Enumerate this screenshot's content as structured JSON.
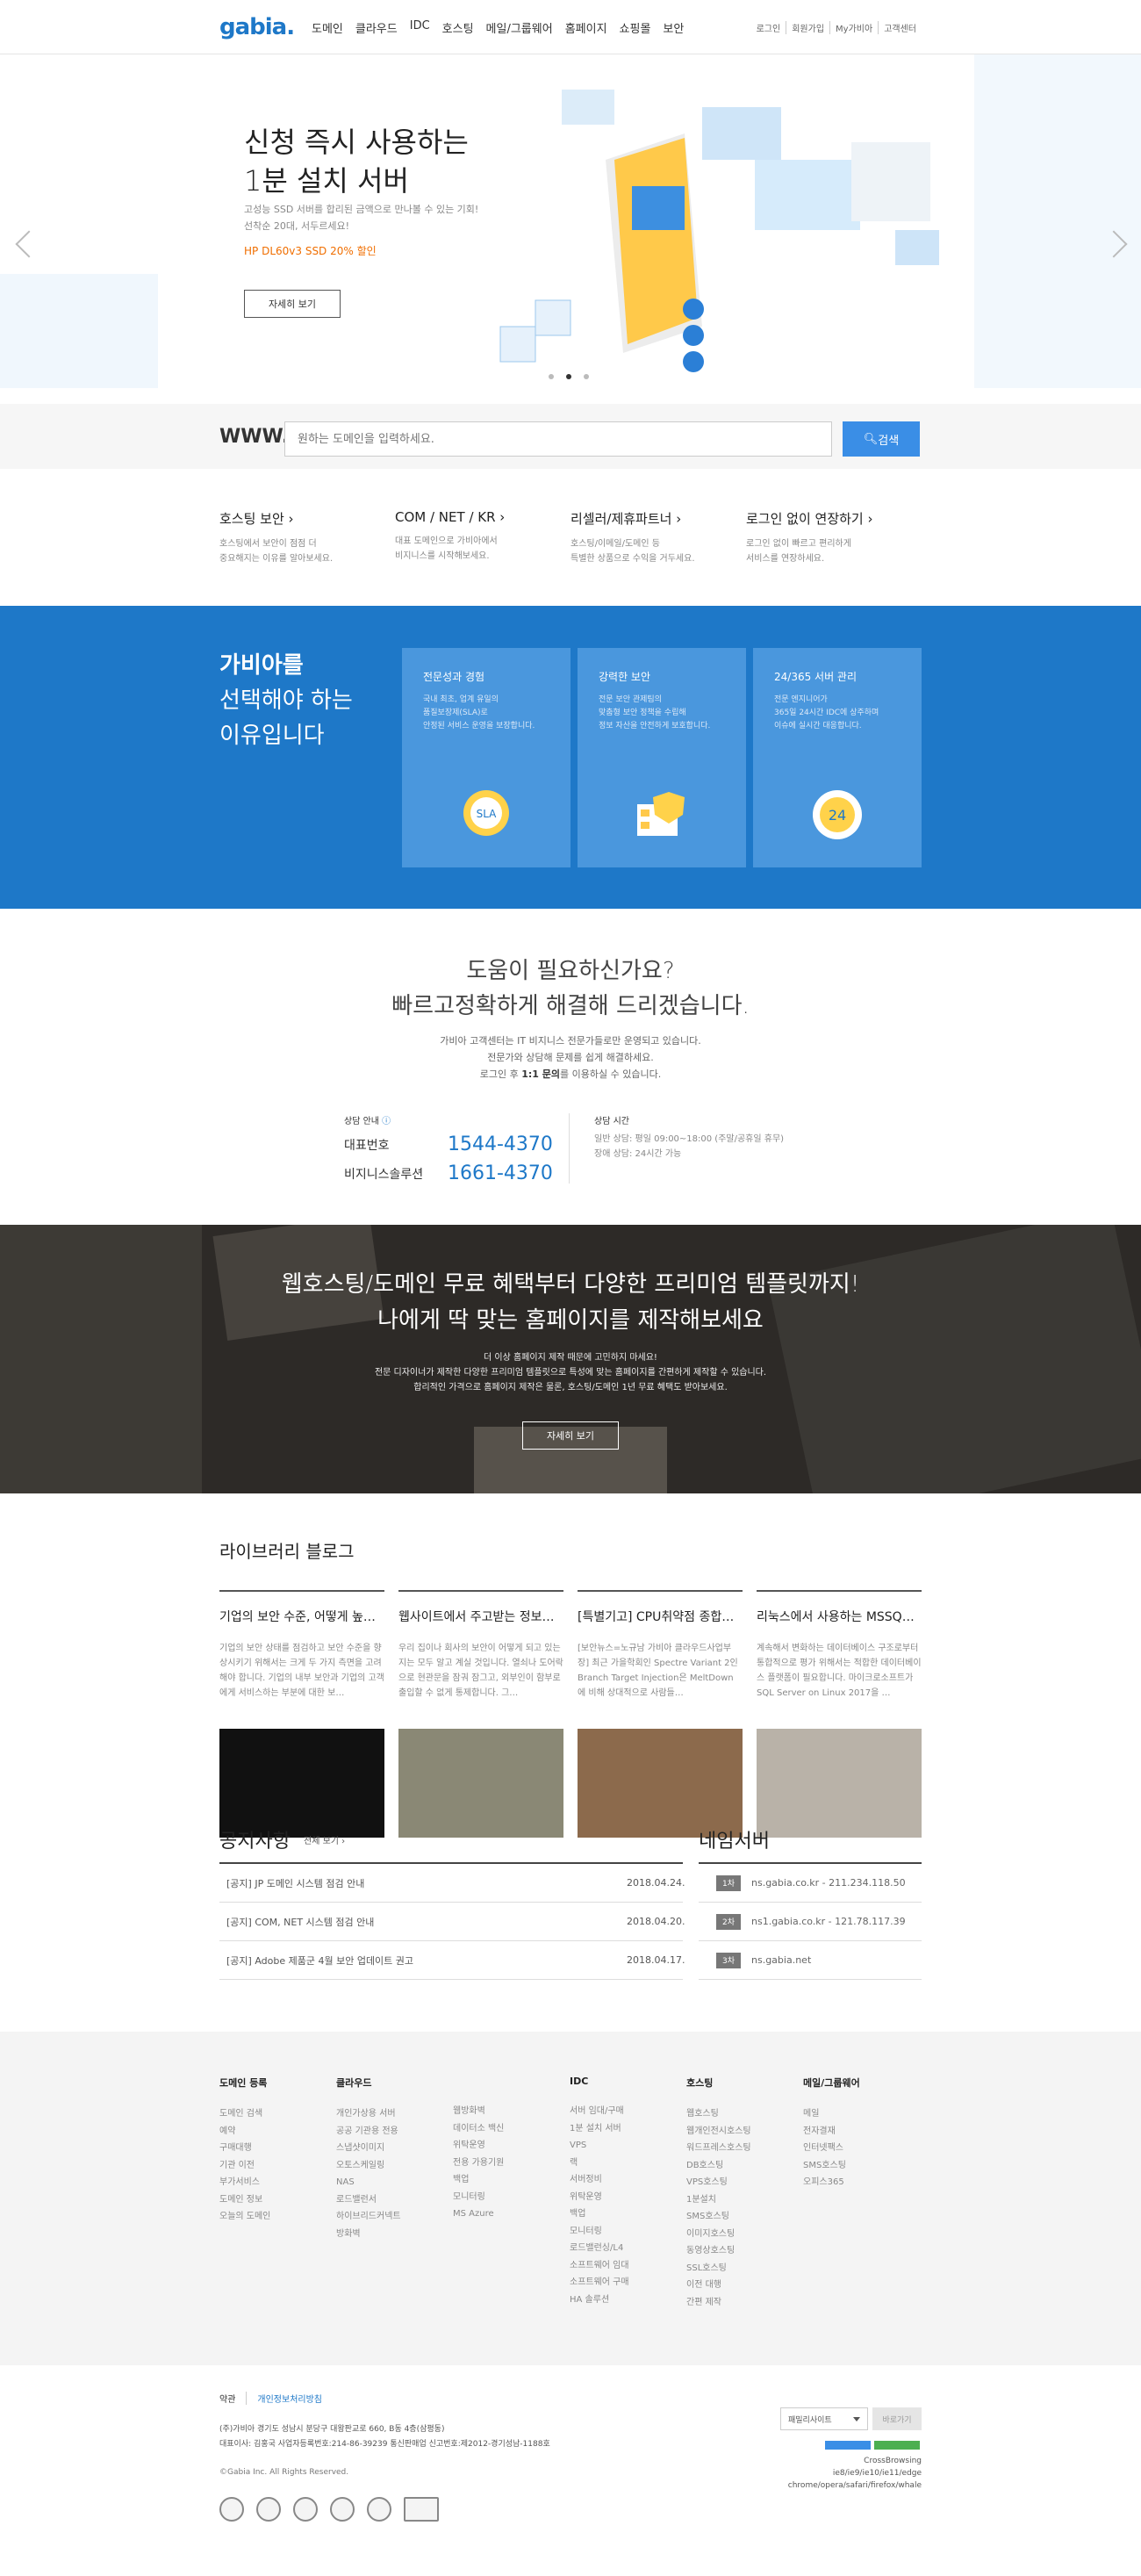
{
  "header": {
    "logo": "gabia.",
    "nav": [
      "도메인",
      "클라우드",
      "IDC",
      "호스팅",
      "메일/그룹웨어",
      "홈페이지",
      "쇼핑몰",
      "보안"
    ],
    "util": [
      "로그인",
      "회원가입",
      "My가비아",
      "고객센터"
    ]
  },
  "hero": {
    "title_line1": "신청 즉시 사용하는",
    "title_line2": "1분 설치 서버",
    "desc_line1": "고성능 SSD 서버를 합리된 금액으로 만나볼 수 있는 기회!",
    "desc_line2": "선착순 20대, 서두르세요!",
    "promo": "HP DL60v3 SSD 20% 할인",
    "button": "자세히 보기"
  },
  "search": {
    "label": "WWW.",
    "placeholder": "원하는 도메인을 입력하세요.",
    "button": "검색"
  },
  "quick_links": [
    {
      "title": "호스팅 보안 ›",
      "desc1": "호스팅에서 보안이 점점 더",
      "desc2": "중요해지는 이유를 알아보세요."
    },
    {
      "title": "COM / NET / KR ›",
      "desc1": "대표 도메인으로 가비아에서",
      "desc2": "비지니스를 시작해보세요."
    },
    {
      "title": "리셀러/제휴파트너 ›",
      "desc1": "호스팅/이메일/도메인 등",
      "desc2": "특별한 상품으로 수익을 거두세요."
    },
    {
      "title": "로그인 없이 연장하기 ›",
      "desc1": "로그인 없이 빠르고 편리하게",
      "desc2": "서비스를 연장하세요."
    }
  ],
  "why": {
    "title_line1": "가비아를",
    "title_line2": "선택해야 하는",
    "title_line3": "이유입니다",
    "cards": [
      {
        "title": "전문성과 경험",
        "d1": "국내 최초, 업계 유일의",
        "d2": "품질보장제(SLA)로",
        "d3": "안정된 서비스 운영을 보장합니다.",
        "icon": "sla-badge-icon"
      },
      {
        "title": "강력한 보안",
        "d1": "전문 보안 관제팀의",
        "d2": "맞춤형 보안 정책을 수립해",
        "d3": "정보 자산을 안전하게 보호합니다.",
        "icon": "shield-server-icon"
      },
      {
        "title": "24/365 서버 관리",
        "d1": "전문 엔지니어가",
        "d2": "365일 24시간 IDC에 상주하며",
        "d3": "이슈에 실시간 대응합니다.",
        "icon": "clock-24-icon"
      }
    ]
  },
  "help": {
    "title_line1": "도움이 필요하신가요?",
    "title_line2": "빠르고정확하게 해결해 드리겠습니다.",
    "desc1": "가비아 고객센터는 IT 비지니스 전문가들로만 운영되고 있습니다.",
    "desc2": "전문가와 상담해 문제를 쉽게 해결하세요.",
    "desc3_pre": "로그인 후 ",
    "desc3_bold": "1:1 문의",
    "desc3_post": "를 이용하실 수 있습니다.",
    "contact_label": "상담 안내",
    "rows": [
      {
        "name": "대표번호",
        "value": "1544-4370"
      },
      {
        "name": "비지니스솔루션",
        "value": "1661-4370"
      }
    ],
    "hours_label": "상담 시간",
    "hours1": "일반 상담: 평일 09:00~18:00 (주말/공휴일 휴무)",
    "hours2": "장애 상담: 24시간 가능"
  },
  "banner": {
    "title_line1": "웹호스팅/도메인 무료 혜택부터 다양한 프리미엄 템플릿까지!",
    "title_line2": "나에게 딱 맞는 홈페이지를 제작해보세요",
    "desc1": "더 이상 홈페이지 제작 때문에 고민하지 마세요!",
    "desc2": "전문 디자이너가 제작한 다양한 프리미엄 템플릿으로 특성에 맞는 홈페이지를 간편하게 제작할 수 있습니다.",
    "desc3": "합리적인 가격으로 홈페이지 제작은 물론, 호스팅/도메인 1년 무료 혜택도 받아보세요.",
    "button": "자세히 보기"
  },
  "blog": {
    "title": "라이브러리 블로그",
    "posts": [
      {
        "title": "기업의 보안 수준, 어떻게 높…",
        "text": "기업의 보안 상태를 점검하고 보안 수준을 향상시키기 위해서는 크게 두 가지 측면을 고려해야 합니다. 기업의 내부 보안과 기업의 고객에게 서비스하는 부분에 대한 보…",
        "img": "code-screen-image"
      },
      {
        "title": "웹사이트에서 주고받는 정보…",
        "text": "우리 집이나 회사의 보안이 어떻게 되고 있는 지는 모두 알고 계실 것입니다. 열쇠나 도어락으로 현관문을 잠궈 잠그고, 외부인이 함부로 출입할 수 없게 통제합니다. 그…",
        "img": "money-image"
      },
      {
        "title": "[특별기고] CPU취약점 종합…",
        "text": "[보안뉴스=노규남 가비아 클라우드사업부장] 최근 가을학회인 Spectre Variant 2인 Branch Target Injection은 MeltDown 에 비해 상대적으로 사람들…",
        "img": "camera-desk-image"
      },
      {
        "title": "리눅스에서 사용하는 MSSQ…",
        "text": "계속해서 변화하는 데이터베이스 구조로부터 통합적으로 평가 위해서는 적합한 데이터베이스 플랫폼이 필요합니다. 마이크로소프트가 SQL Server on Linux 2017을 …",
        "img": "laptop-image"
      }
    ]
  },
  "notice": {
    "title": "공지사항",
    "more": "전체 보기 ›",
    "items": [
      {
        "title": "[공지] JP 도메인 시스템 점검 안내",
        "date": "2018.04.24."
      },
      {
        "title": "[공지] COM, NET 시스템 점검 안내",
        "date": "2018.04.20."
      },
      {
        "title": "[공지] Adobe 제품군 4월 보안 업데이트 권고",
        "date": "2018.04.17."
      }
    ]
  },
  "nameserver": {
    "title": "네임서버",
    "items": [
      {
        "badge": "1차",
        "value": "ns.gabia.co.kr - 211.234.118.50"
      },
      {
        "badge": "2차",
        "value": "ns1.gabia.co.kr - 121.78.117.39"
      },
      {
        "badge": "3차",
        "value": "ns.gabia.net"
      }
    ]
  },
  "sitemap": [
    {
      "title": "도메인 등록",
      "items": [
        "도메인 검색",
        "예약",
        "구매대행",
        "기관 이전",
        "부가서비스",
        "도메인 정보",
        "오늘의 도메인"
      ]
    },
    {
      "title": "클라우드",
      "items": [
        "개인가상용 서버",
        "공공 기관용 전용",
        "스냅샷이미지",
        "오토스케일링",
        "NAS",
        "로드밸런서",
        "하이브리드커넥트",
        "방화벽"
      ]
    },
    {
      "title": "",
      "items": [
        "웹방화벽",
        "데이터소 백신",
        "위탁운영",
        "전용 가용기원",
        "백업",
        "모니터링",
        "MS Azure"
      ]
    },
    {
      "title": "IDC",
      "items": [
        "서버 임대/구매",
        "1분 설치 서버",
        "VPS",
        "랙",
        "서버정비",
        "위탁운영",
        "백업",
        "모니터링",
        "로드밸런싱/L4",
        "소프트웨어 임대",
        "소프트웨어 구매",
        "HA 솔루션"
      ]
    },
    {
      "title": "호스팅",
      "items": [
        "웹호스팅",
        "웹개인전시호스팅",
        "워드프레스호스팅",
        "DB호스팅",
        "VPS호스팅",
        "1분설치",
        "SMS호스팅",
        "이미지호스팅",
        "동영상호스팅",
        "SSL호스팅",
        "이전 대행",
        "간편 제작"
      ]
    },
    {
      "title": "메일/그룹웨어",
      "items": [
        "메일",
        "전자결재",
        "인터넷팩스",
        "SMS호스팅",
        "오피스365"
      ]
    }
  ],
  "footer": {
    "links": [
      "약관",
      "개인정보처리방침"
    ],
    "addr1": "(주)가비아    경기도 성남시 분당구 대왕판교로 660, B동 4층(삼평동)",
    "addr2": "대표이사: 김홍국    사업자등록번호:214-86-39239    통신판매업 신고번호:제2012-경기성남-1188호",
    "copyright": "©Gabia Inc. All Rights Reserved.",
    "family_site": "패밀리사이트",
    "move": "바로가기",
    "browser1": "CrossBrowsing",
    "browser2": "ie8/ie9/ie10/ie11/edge",
    "browser3": "chrome/opera/safari/firefox/whale"
  },
  "colors": {
    "brand": "#1e78c8",
    "accent": "#3a8ee6",
    "promo": "#f06e00"
  }
}
